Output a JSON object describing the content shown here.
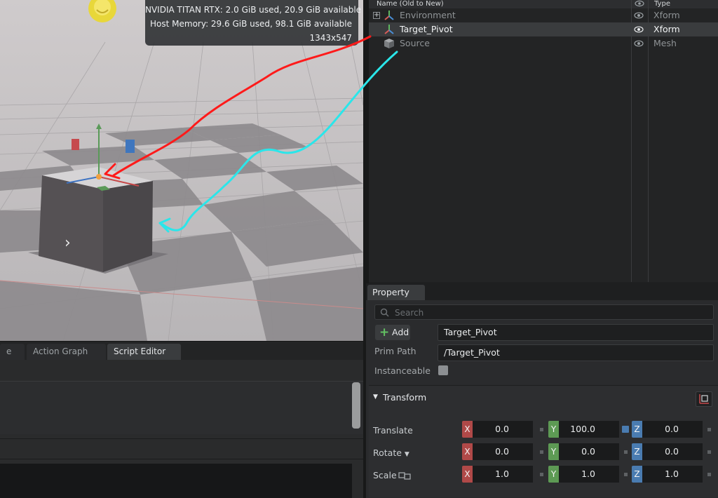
{
  "viewport": {
    "gpu_line": "NVIDIA TITAN RTX: 2.0 GiB used, 20.9 GiB available",
    "host_line": "Host Memory: 29.6 GiB used, 98.1 GiB available",
    "resolution_line": "1343x547"
  },
  "bottom_tabs": [
    {
      "label": "e"
    },
    {
      "label": "Action Graph"
    },
    {
      "label": "Script Editor"
    }
  ],
  "stage": {
    "col_name": "Name (Old to New)",
    "col_type": "Type",
    "rows": [
      {
        "label": "Environment",
        "type": "Xform",
        "icon": "xform-axes-icon",
        "selected": false
      },
      {
        "label": "Target_Pivot",
        "type": "Xform",
        "icon": "xform-axes-icon",
        "selected": true
      },
      {
        "label": "Source",
        "type": "Mesh",
        "icon": "mesh-cube-icon",
        "selected": false
      }
    ]
  },
  "property": {
    "tab": "Property",
    "search_placeholder": "Search",
    "add_label": "Add",
    "prim_name": "Target_Pivot",
    "prim_path_label": "Prim Path",
    "prim_path": "/Target_Pivot",
    "instanceable_label": "Instanceable",
    "transform": {
      "title": "Transform",
      "translate_label": "Translate",
      "rotate_label": "Rotate",
      "scale_label": "Scale",
      "axis_labels": [
        "X",
        "Y",
        "Z"
      ],
      "translate": [
        "0.0",
        "100.0",
        "0.0"
      ],
      "rotate": [
        "0.0",
        "0.0",
        "0.0"
      ],
      "scale": [
        "1.0",
        "1.0",
        "1.0"
      ]
    }
  },
  "colors": {
    "accent_blue": "#4a7cb1",
    "axis_x": "#b04948",
    "axis_y": "#5d9a54",
    "annotation_red": "#ff1a1a",
    "annotation_cyan": "#2ae6ea"
  }
}
